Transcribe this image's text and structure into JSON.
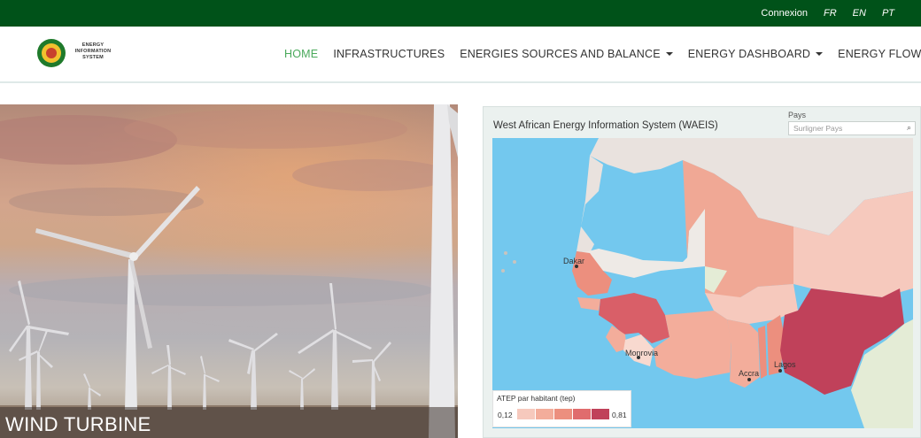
{
  "topbar": {
    "connexion": "Connexion",
    "languages": [
      "FR",
      "EN",
      "PT"
    ]
  },
  "logo": {
    "text_line1": "ENERGY",
    "text_line2": "INFORMATION",
    "text_line3": "SYSTEM"
  },
  "nav": {
    "items": [
      {
        "label": "HOME",
        "active": true,
        "dropdown": false
      },
      {
        "label": "INFRASTRUCTURES",
        "active": false,
        "dropdown": false
      },
      {
        "label": "ENERGIES SOURCES AND BALANCE",
        "active": false,
        "dropdown": true
      },
      {
        "label": "ENERGY DASHBOARD",
        "active": false,
        "dropdown": true
      },
      {
        "label": "ENERGY FLOW",
        "active": false,
        "dropdown": false
      }
    ]
  },
  "hero": {
    "caption": "WIND TURBINE"
  },
  "map_panel": {
    "title": "West African Energy Information System (WAEIS)",
    "filter_label": "Pays",
    "filter_placeholder": "Surligner Pays",
    "cities": [
      "Dakar",
      "Monrovia",
      "Accra",
      "Lagos"
    ],
    "legend": {
      "title": "ATEP par habitant (tep)",
      "min": "0,12",
      "max": "0,81",
      "colors": [
        "#f6c9bd",
        "#f3ad9b",
        "#ec8f7e",
        "#e06c6d",
        "#c0415a"
      ]
    }
  },
  "colors": {
    "topbar": "#005219",
    "active_nav": "#4aa95b",
    "ocean": "#73c8ee"
  }
}
